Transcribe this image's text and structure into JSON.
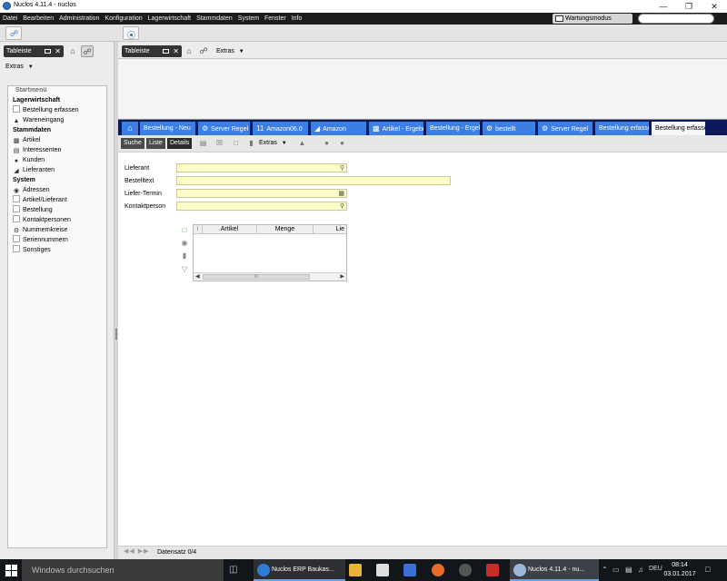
{
  "window": {
    "title": "Nuclos 4.11.4 - nuclos",
    "minimize_icon": "minimize-icon",
    "maximize_icon": "maximize-icon",
    "close_icon": "close-icon"
  },
  "menubar": {
    "items": [
      "Datei",
      "Bearbeiten",
      "Administration",
      "Konfiguration",
      "Lagerwirtschaft",
      "Stammdaten",
      "System",
      "Fenster",
      "Info"
    ],
    "maintenance_label": "Wartungsmodus",
    "search_placeholder": ""
  },
  "left": {
    "tableiste_label": "Tableiste",
    "extras_label": "Extras",
    "startmenu_header": "Startmenü",
    "items": [
      {
        "label": "Lagerwirtschaft",
        "bold": true,
        "icon": ""
      },
      {
        "label": "Bestellung erfassen",
        "bold": false,
        "icon": "empty-icon"
      },
      {
        "label": "Wareneingang",
        "bold": false,
        "icon": "inbox-icon"
      },
      {
        "label": "Stammdaten",
        "bold": true,
        "icon": ""
      },
      {
        "label": "Artikel",
        "bold": false,
        "icon": "articles-icon"
      },
      {
        "label": "Interessenten",
        "bold": false,
        "icon": "contact-card-icon"
      },
      {
        "label": "Kunden",
        "bold": false,
        "icon": "customers-icon"
      },
      {
        "label": "Lieferanten",
        "bold": false,
        "icon": "forklift-icon"
      },
      {
        "label": "System",
        "bold": true,
        "icon": ""
      },
      {
        "label": "Adressen",
        "bold": false,
        "icon": "pin-icon"
      },
      {
        "label": "Artikel/Lieferant",
        "bold": false,
        "icon": "empty-icon"
      },
      {
        "label": "Bestellung",
        "bold": false,
        "icon": "empty-icon"
      },
      {
        "label": "Kontaktpersonen",
        "bold": false,
        "icon": "empty-icon"
      },
      {
        "label": "Nummernkreise",
        "bold": false,
        "icon": "gear-icon"
      },
      {
        "label": "Seriennummern",
        "bold": false,
        "icon": "empty-icon"
      },
      {
        "label": "Sonstiges",
        "bold": false,
        "icon": "empty-icon"
      }
    ]
  },
  "right": {
    "tableiste_label": "Tableiste",
    "extras_label": "Extras"
  },
  "doctabs": [
    {
      "label": "Bestellung - Neu",
      "active": false,
      "icon": "document-icon"
    },
    {
      "label": "Server Regel",
      "active": false,
      "icon": "gear-icon"
    },
    {
      "label": "Amazon06.0",
      "active": false,
      "icon": "number-icon"
    },
    {
      "label": "Amazon",
      "active": false,
      "icon": "forklift-icon"
    },
    {
      "label": "Artikel - Ergebnis",
      "active": false,
      "icon": "articles-icon"
    },
    {
      "label": "Bestellung - Ergebnis",
      "active": false,
      "icon": "document-icon"
    },
    {
      "label": "bestellt",
      "active": false,
      "icon": "gear-icon"
    },
    {
      "label": "Server Regel",
      "active": false,
      "icon": "gear-icon"
    },
    {
      "label": "Bestellung erfassen",
      "active": false,
      "icon": "document-icon"
    },
    {
      "label": "Bestellung erfassen",
      "active": true,
      "icon": "document-icon"
    }
  ],
  "content": {
    "view_modes": [
      "Suche",
      "Liste",
      "Details"
    ],
    "extras_label": "Extras",
    "fields": [
      {
        "label": "Lieferant",
        "value": "",
        "icon": "search-icon"
      },
      {
        "label": "Bestelltext",
        "value": "",
        "icon": ""
      },
      {
        "label": "Liefer-Termin",
        "value": "",
        "icon": "calendar-icon"
      },
      {
        "label": "Kontaktperson",
        "value": "",
        "icon": "search-icon"
      }
    ],
    "subform": {
      "columns": [
        "Artikel",
        "Menge",
        "Lie"
      ],
      "scroll_thumb": "III"
    }
  },
  "status": {
    "record_count": "Datensatz 0/4"
  },
  "taskbar": {
    "search_placeholder": "Windows durchsuchen",
    "apps": [
      {
        "label": "Nuclos ERP Baukas...",
        "icon": "edge-icon"
      },
      {
        "label": "Nuclos 4.11.4 - nu...",
        "icon": "nuclos-icon"
      }
    ],
    "language": "DEU",
    "time": "08:14",
    "date": "03.01.2017"
  }
}
